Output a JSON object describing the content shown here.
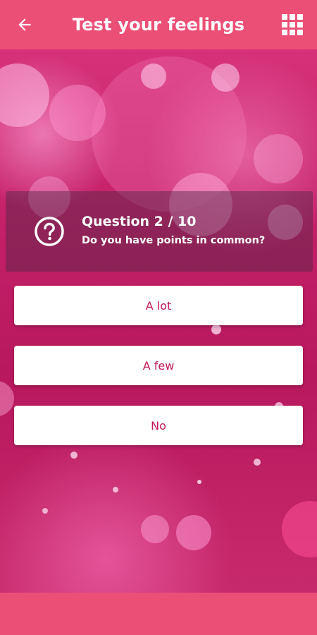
{
  "header": {
    "title": "Test your feelings",
    "back_icon": "arrow-left-icon",
    "menu_icon": "grid-icon"
  },
  "question": {
    "number": "Question 2 / 10",
    "text": "Do you have points in common?",
    "icon": "question-circle-icon"
  },
  "answers": [
    {
      "label": "A lot"
    },
    {
      "label": "A few"
    },
    {
      "label": "No"
    }
  ],
  "colors": {
    "bar": "#ec4f76",
    "answer_text": "#c2185b",
    "panel": "rgba(80,40,70,0.45)"
  }
}
